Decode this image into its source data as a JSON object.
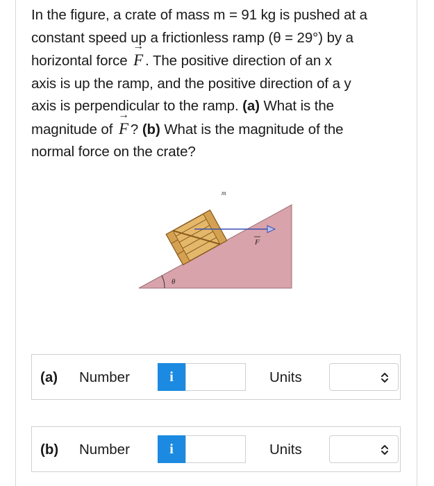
{
  "question": {
    "line1": "In the figure, a crate of mass m = 91 kg is pushed at a",
    "line2": "constant speed up a frictionless ramp (θ = 29°) by a",
    "line3_before": "horizontal force",
    "line3_after": ". The positive direction of an x",
    "line4": "axis is up the ramp, and the positive direction of a y",
    "line5_text": "axis is perpendicular to the ramp.",
    "line5_part": "(a)",
    "line5_tail": "What is the",
    "line6_before": "magnitude of",
    "line6_mid": "?",
    "line6_part": "(b)",
    "line6_after": "What is the magnitude of the",
    "line7": "normal force on the crate?",
    "force_symbol": "F",
    "vector_arrow": "→"
  },
  "figure": {
    "mass_label": "m",
    "force_label": "F",
    "angle_label": "θ",
    "ramp_color": "#d9a3ab",
    "crate_color": "#e3b86a",
    "arrow_color": "#3a4fb0"
  },
  "answers": [
    {
      "part": "(a)",
      "number_label": "Number",
      "info": "i",
      "value": "",
      "units_label": "Units",
      "units_value": ""
    },
    {
      "part": "(b)",
      "number_label": "Number",
      "info": "i",
      "value": "",
      "units_label": "Units",
      "units_value": ""
    }
  ]
}
